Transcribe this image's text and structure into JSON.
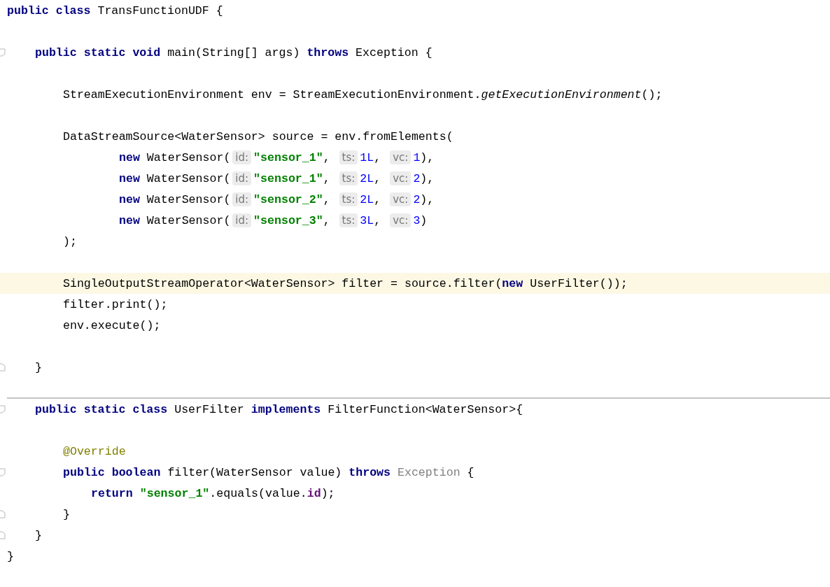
{
  "editor": {
    "lines": [
      {
        "kind": "code",
        "tokens": [
          {
            "kind": "kw",
            "text": "public class "
          },
          {
            "kind": "plain",
            "text": "TransFunctionUDF {"
          }
        ],
        "children": [
          {
            "kind": "blank"
          },
          {
            "kind": "code",
            "foldable": true,
            "tokens": [
              {
                "kind": "kw",
                "text": "public static void "
              },
              {
                "kind": "plain",
                "text": "main(String[] args) "
              },
              {
                "kind": "kw",
                "text": "throws "
              },
              {
                "kind": "plain",
                "text": "Exception {"
              }
            ],
            "children": [
              {
                "kind": "blank"
              },
              {
                "kind": "code",
                "tokens": [
                  {
                    "kind": "plain",
                    "text": "StreamExecutionEnvironment env = StreamExecutionEnvironment."
                  },
                  {
                    "kind": "static",
                    "text": "getExecutionEnvironment"
                  },
                  {
                    "kind": "plain",
                    "text": "();"
                  }
                ]
              },
              {
                "kind": "blank"
              },
              {
                "kind": "code",
                "tokens": [
                  {
                    "kind": "plain",
                    "text": "DataStreamSource<WaterSensor> source = env.fromElements("
                  }
                ],
                "children": [
                  {
                    "kind": "continued",
                    "tokens": [
                      {
                        "kind": "kw",
                        "text": "new "
                      },
                      {
                        "kind": "plain",
                        "text": "WaterSensor("
                      },
                      {
                        "kind": "hint",
                        "text": "id:"
                      },
                      {
                        "kind": "str",
                        "text": "\"sensor_1\""
                      },
                      {
                        "kind": "plain",
                        "text": ", "
                      },
                      {
                        "kind": "hint",
                        "text": "ts:"
                      },
                      {
                        "kind": "num",
                        "text": "1L"
                      },
                      {
                        "kind": "plain",
                        "text": ", "
                      },
                      {
                        "kind": "hint",
                        "text": "vc:"
                      },
                      {
                        "kind": "num",
                        "text": "1"
                      },
                      {
                        "kind": "plain",
                        "text": "),"
                      }
                    ]
                  },
                  {
                    "kind": "continued",
                    "tokens": [
                      {
                        "kind": "kw",
                        "text": "new "
                      },
                      {
                        "kind": "plain",
                        "text": "WaterSensor("
                      },
                      {
                        "kind": "hint",
                        "text": "id:"
                      },
                      {
                        "kind": "str",
                        "text": "\"sensor_1\""
                      },
                      {
                        "kind": "plain",
                        "text": ", "
                      },
                      {
                        "kind": "hint",
                        "text": "ts:"
                      },
                      {
                        "kind": "num",
                        "text": "2L"
                      },
                      {
                        "kind": "plain",
                        "text": ", "
                      },
                      {
                        "kind": "hint",
                        "text": "vc:"
                      },
                      {
                        "kind": "num",
                        "text": "2"
                      },
                      {
                        "kind": "plain",
                        "text": "),"
                      }
                    ]
                  },
                  {
                    "kind": "continued",
                    "tokens": [
                      {
                        "kind": "kw",
                        "text": "new "
                      },
                      {
                        "kind": "plain",
                        "text": "WaterSensor("
                      },
                      {
                        "kind": "hint",
                        "text": "id:"
                      },
                      {
                        "kind": "str",
                        "text": "\"sensor_2\""
                      },
                      {
                        "kind": "plain",
                        "text": ", "
                      },
                      {
                        "kind": "hint",
                        "text": "ts:"
                      },
                      {
                        "kind": "num",
                        "text": "2L"
                      },
                      {
                        "kind": "plain",
                        "text": ", "
                      },
                      {
                        "kind": "hint",
                        "text": "vc:"
                      },
                      {
                        "kind": "num",
                        "text": "2"
                      },
                      {
                        "kind": "plain",
                        "text": "),"
                      }
                    ]
                  },
                  {
                    "kind": "continued",
                    "tokens": [
                      {
                        "kind": "kw",
                        "text": "new "
                      },
                      {
                        "kind": "plain",
                        "text": "WaterSensor("
                      },
                      {
                        "kind": "hint",
                        "text": "id:"
                      },
                      {
                        "kind": "str",
                        "text": "\"sensor_3\""
                      },
                      {
                        "kind": "plain",
                        "text": ", "
                      },
                      {
                        "kind": "hint",
                        "text": "ts:"
                      },
                      {
                        "kind": "num",
                        "text": "3L"
                      },
                      {
                        "kind": "plain",
                        "text": ", "
                      },
                      {
                        "kind": "hint",
                        "text": "vc:"
                      },
                      {
                        "kind": "num",
                        "text": "3"
                      },
                      {
                        "kind": "plain",
                        "text": ")"
                      }
                    ]
                  }
                ]
              },
              {
                "kind": "code",
                "tokens": [
                  {
                    "kind": "plain",
                    "text": ");"
                  }
                ]
              },
              {
                "kind": "blank"
              },
              {
                "kind": "code",
                "current": true,
                "tokens": [
                  {
                    "kind": "plain",
                    "text": "SingleOutputStreamOperator<WaterSensor> filter = source.filter("
                  },
                  {
                    "kind": "kw",
                    "text": "new "
                  },
                  {
                    "kind": "plain",
                    "text": "UserFilter());"
                  }
                ]
              },
              {
                "kind": "code",
                "tokens": [
                  {
                    "kind": "plain",
                    "text": "filter.print();"
                  }
                ]
              },
              {
                "kind": "code",
                "tokens": [
                  {
                    "kind": "plain",
                    "text": "env.execute();"
                  }
                ]
              },
              {
                "kind": "blank"
              }
            ]
          },
          {
            "kind": "code",
            "block_end": true,
            "tokens": [
              {
                "kind": "plain",
                "text": "}"
              }
            ]
          },
          {
            "kind": "blank"
          },
          {
            "kind": "code",
            "separator": true,
            "foldable": true,
            "tokens": [
              {
                "kind": "kw",
                "text": "public static class "
              },
              {
                "kind": "plain",
                "text": "UserFilter "
              },
              {
                "kind": "kw",
                "text": "implements "
              },
              {
                "kind": "plain",
                "text": "FilterFunction<WaterSensor>{"
              }
            ],
            "children": [
              {
                "kind": "blank"
              },
              {
                "kind": "code",
                "tokens": [
                  {
                    "kind": "annot",
                    "text": "@Override"
                  }
                ]
              },
              {
                "kind": "code",
                "foldable": true,
                "tokens": [
                  {
                    "kind": "kw",
                    "text": "public boolean "
                  },
                  {
                    "kind": "plain",
                    "text": "filter(WaterSensor value) "
                  },
                  {
                    "kind": "kw",
                    "text": "throws "
                  },
                  {
                    "kind": "dim",
                    "text": "Exception"
                  },
                  {
                    "kind": "plain",
                    "text": " {"
                  }
                ],
                "children": [
                  {
                    "kind": "code",
                    "tokens": [
                      {
                        "kind": "kw",
                        "text": "return "
                      },
                      {
                        "kind": "str",
                        "text": "\"sensor_1\""
                      },
                      {
                        "kind": "plain",
                        "text": ".equals(value."
                      },
                      {
                        "kind": "field",
                        "text": "id"
                      },
                      {
                        "kind": "plain",
                        "text": ");"
                      }
                    ]
                  }
                ]
              },
              {
                "kind": "code",
                "block_end": true,
                "tokens": [
                  {
                    "kind": "plain",
                    "text": "}"
                  }
                ]
              }
            ]
          },
          {
            "kind": "code",
            "block_end": true,
            "tokens": [
              {
                "kind": "plain",
                "text": "}"
              }
            ]
          }
        ]
      },
      {
        "kind": "code",
        "tokens": [
          {
            "kind": "plain",
            "text": "}"
          }
        ]
      }
    ]
  }
}
